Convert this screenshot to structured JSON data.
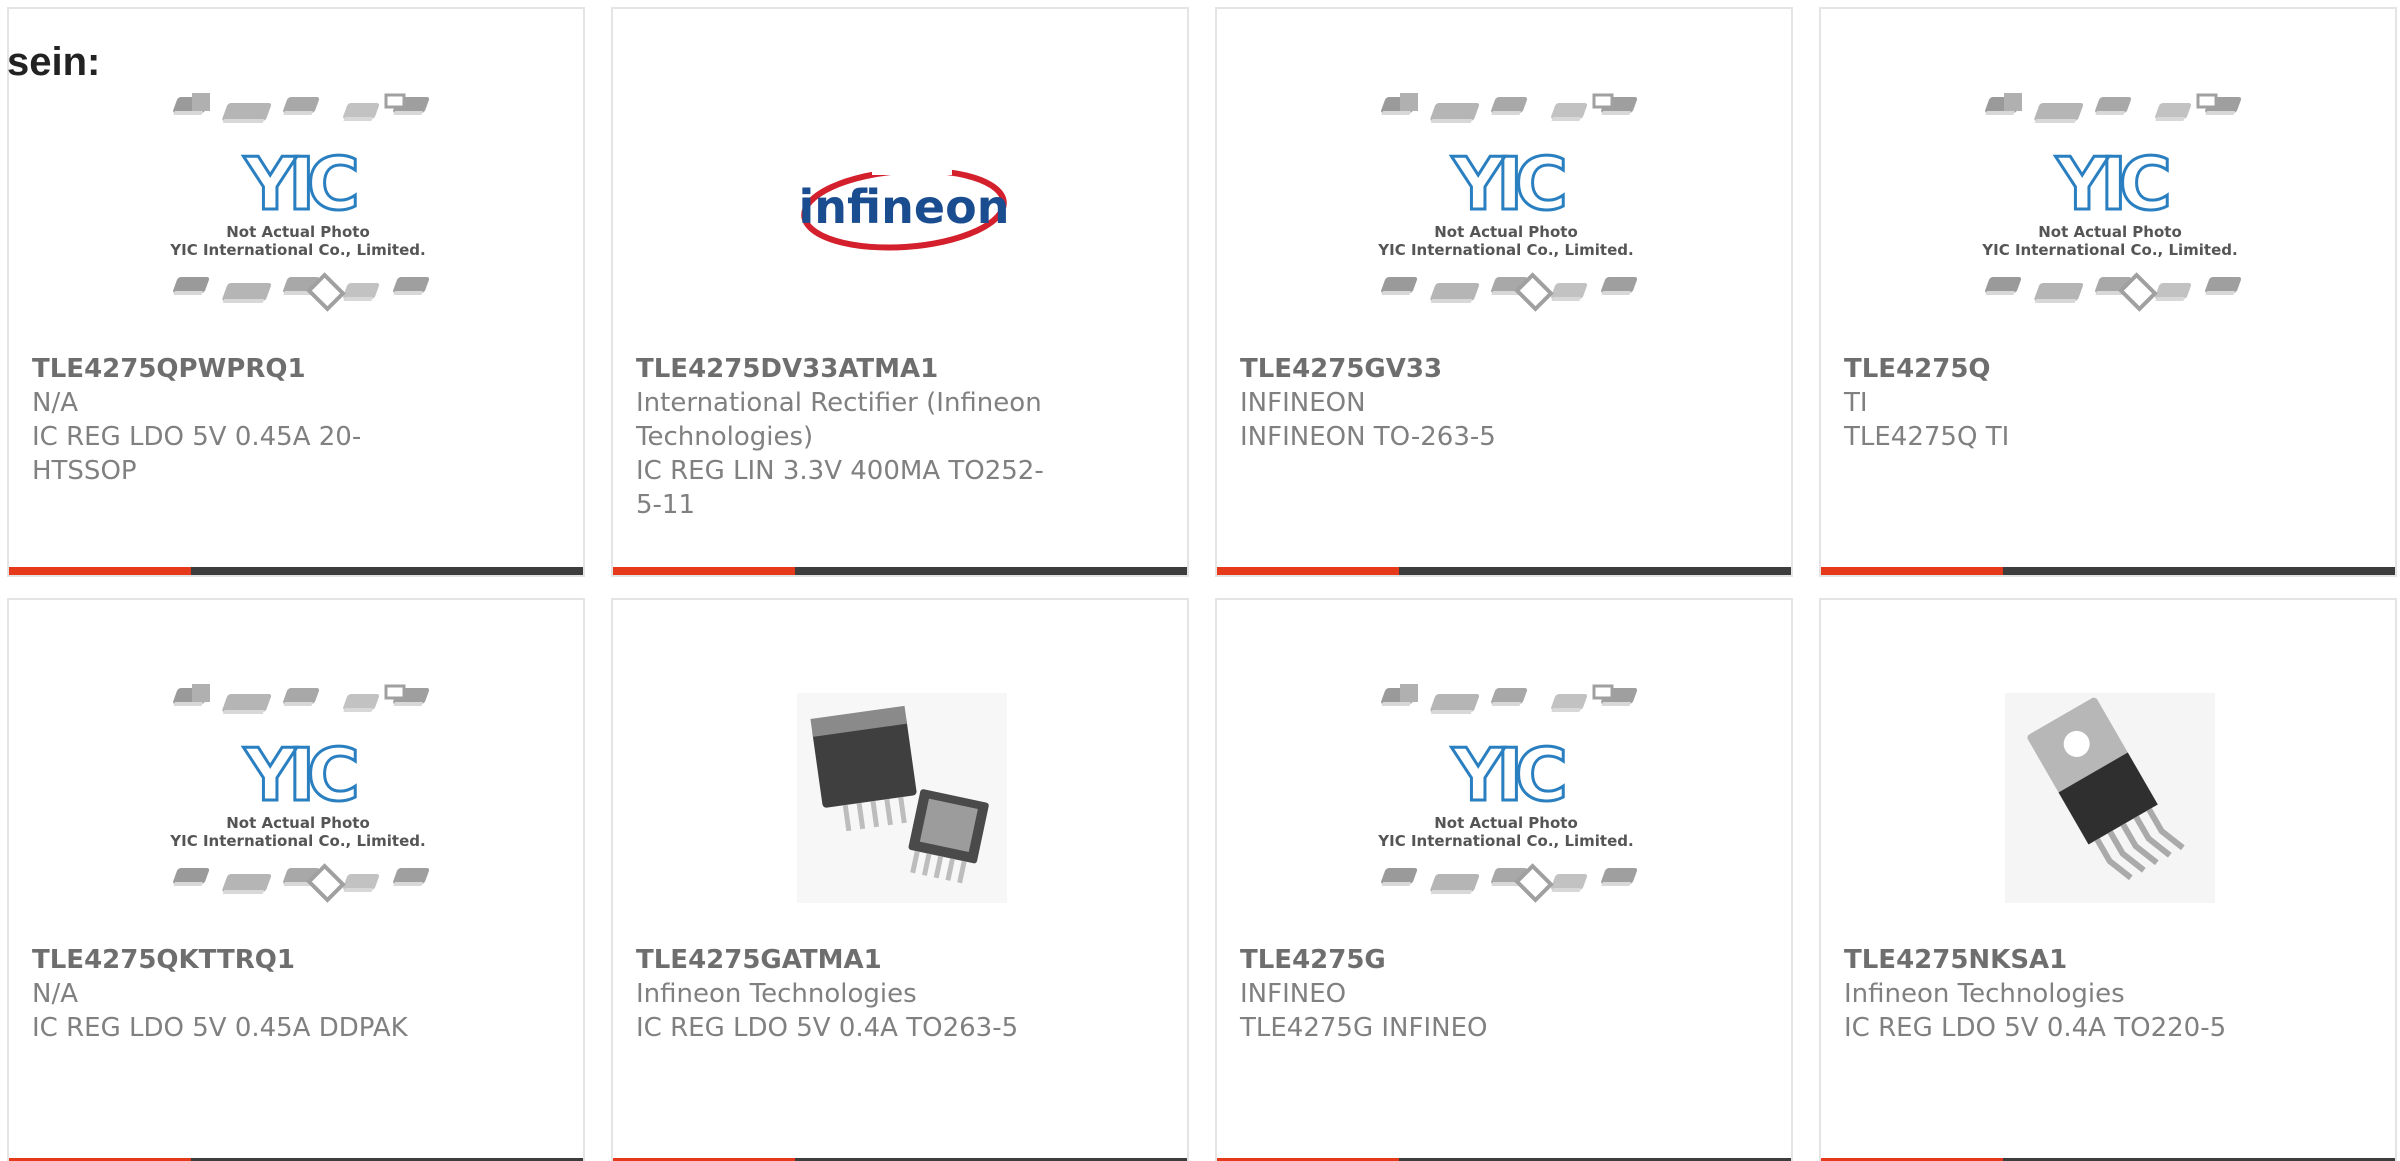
{
  "heading": "sein:",
  "placeholder_image": {
    "logo_text": "YIC",
    "line1": "Not Actual Photo",
    "line2": "YIC International Co., Limited."
  },
  "products": [
    {
      "part_number": "TLE4275QPWPRQ1",
      "manufacturer": "N/A",
      "description": "IC REG LDO 5V 0.45A 20-HTSSOP",
      "image": "yic-placeholder"
    },
    {
      "part_number": "TLE4275DV33ATMA1",
      "manufacturer": "International Rectifier (Infineon Technologies)",
      "description": "IC REG LIN 3.3V 400MA TO252-5-11",
      "image": "infineon-logo",
      "logo_text": "infineon"
    },
    {
      "part_number": "TLE4275GV33",
      "manufacturer": "INFINEON",
      "description": "INFINEON TO-263-5",
      "image": "yic-placeholder"
    },
    {
      "part_number": "TLE4275Q",
      "manufacturer": "TI",
      "description": "TLE4275Q TI",
      "image": "yic-placeholder"
    },
    {
      "part_number": "TLE4275QKTTRQ1",
      "manufacturer": "N/A",
      "description": "IC REG LDO 5V 0.45A DDPAK",
      "image": "yic-placeholder"
    },
    {
      "part_number": "TLE4275GATMA1",
      "manufacturer": "Infineon Technologies",
      "description": "IC REG LDO 5V 0.4A TO263-5",
      "image": "to263-photo"
    },
    {
      "part_number": "TLE4275G",
      "manufacturer": "INFINEO",
      "description": "TLE4275G INFINEO",
      "image": "yic-placeholder"
    },
    {
      "part_number": "TLE4275NKSA1",
      "manufacturer": "Infineon Technologies",
      "description": "IC REG LDO 5V 0.4A TO220-5",
      "image": "to220-photo"
    }
  ],
  "colors": {
    "accent": "#e5391a",
    "bar": "#3d3d3d",
    "card_border": "#e4e4e4",
    "text": "#808080",
    "yic_blue": "#2a7fc1",
    "infineon_blue": "#1a4d8f",
    "infineon_red": "#d4202c"
  }
}
